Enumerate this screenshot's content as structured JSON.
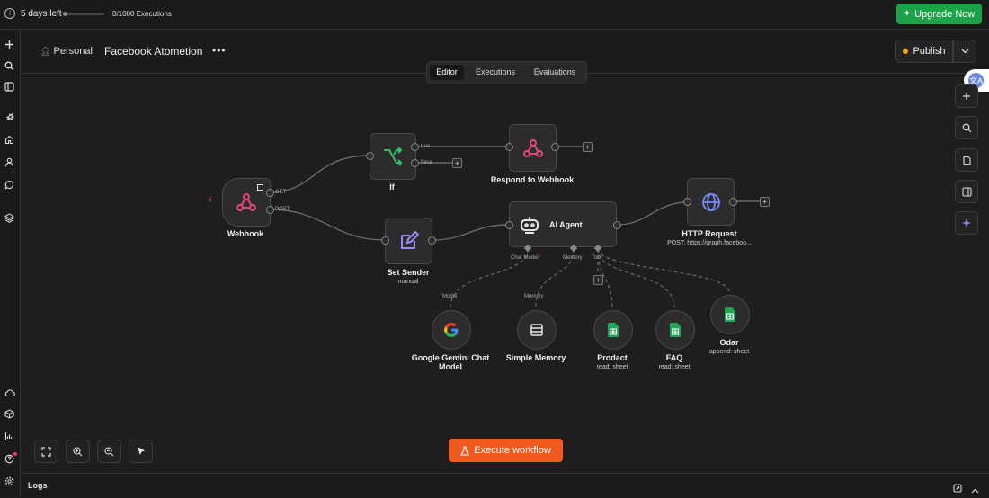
{
  "topbar": {
    "trial_text": "5 days left",
    "executions_text": "0/1000 Executions",
    "executions_used_fraction": 0.0,
    "upgrade_label": "Upgrade Now"
  },
  "header": {
    "scope": "Personal",
    "workflow_name": "Facebook Atometion",
    "more": "•••",
    "publish_label": "Publish"
  },
  "tabs": [
    {
      "label": "Editor",
      "active": true
    },
    {
      "label": "Executions",
      "active": false
    },
    {
      "label": "Evaluations",
      "active": false
    }
  ],
  "nodes": {
    "webhook": {
      "label": "Webhook",
      "out_get": "GET",
      "out_post": "POST"
    },
    "if": {
      "label": "If",
      "out_true": "true",
      "out_false": "false"
    },
    "respond": {
      "label": "Respond to Webhook"
    },
    "set_sender": {
      "label": "Set Sender",
      "sub": "manual"
    },
    "ai_agent": {
      "label": "AI Agent",
      "port_chat_model": "Chat Model",
      "required_mark": "*",
      "port_memory": "Memory",
      "port_tool": "Tool"
    },
    "http": {
      "label": "HTTP Request",
      "sub": "POST: https://graph.faceboo..."
    },
    "gemini": {
      "label_line1": "Google Gemini Chat",
      "label_line2": "Model",
      "in_label": "Model"
    },
    "memory": {
      "label": "Simple Memory",
      "in_label": "Memory"
    },
    "prodact": {
      "label": "Prodact",
      "sub": "read: sheet"
    },
    "faq": {
      "label": "FAQ",
      "sub": "read: sheet"
    },
    "odar": {
      "label": "Odar",
      "sub": "append: sheet"
    }
  },
  "footer": {
    "execute_label": "Execute workflow",
    "logs_label": "Logs"
  },
  "colors": {
    "upgrade": "#1ca34a",
    "execute": "#f05a1e",
    "webhook_icon": "#e8477a",
    "if_icon": "#2ec26a",
    "agent_icon": "#e6e6e6",
    "http_icon": "#7a8cf0",
    "set_icon": "#9b8cf0",
    "sheet_icon": "#21a65a",
    "publish_dot": "#f0a020"
  }
}
